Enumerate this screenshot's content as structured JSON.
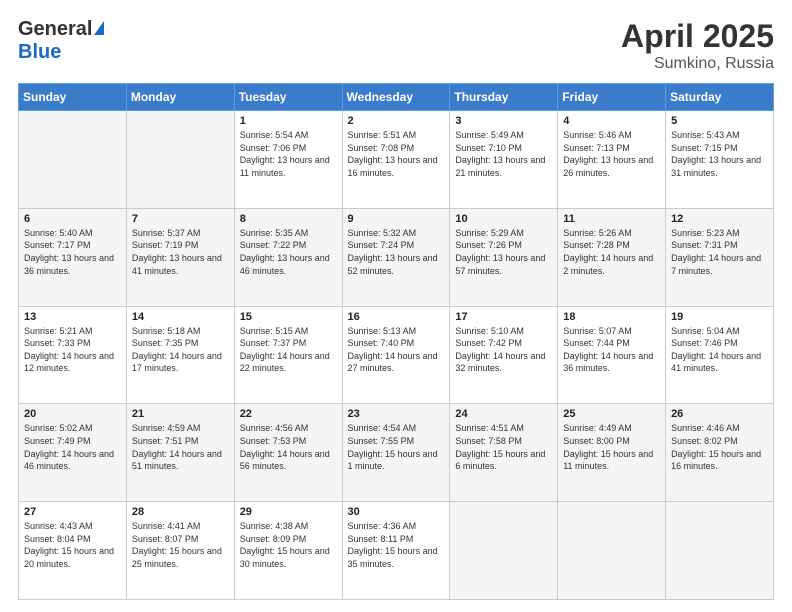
{
  "header": {
    "logo": {
      "general": "General",
      "blue": "Blue"
    },
    "title": "April 2025",
    "location": "Sumkino, Russia"
  },
  "calendar": {
    "days": [
      "Sunday",
      "Monday",
      "Tuesday",
      "Wednesday",
      "Thursday",
      "Friday",
      "Saturday"
    ],
    "weeks": [
      [
        {
          "day": "",
          "info": ""
        },
        {
          "day": "",
          "info": ""
        },
        {
          "day": "1",
          "info": "Sunrise: 5:54 AM\nSunset: 7:06 PM\nDaylight: 13 hours and 11 minutes."
        },
        {
          "day": "2",
          "info": "Sunrise: 5:51 AM\nSunset: 7:08 PM\nDaylight: 13 hours and 16 minutes."
        },
        {
          "day": "3",
          "info": "Sunrise: 5:49 AM\nSunset: 7:10 PM\nDaylight: 13 hours and 21 minutes."
        },
        {
          "day": "4",
          "info": "Sunrise: 5:46 AM\nSunset: 7:13 PM\nDaylight: 13 hours and 26 minutes."
        },
        {
          "day": "5",
          "info": "Sunrise: 5:43 AM\nSunset: 7:15 PM\nDaylight: 13 hours and 31 minutes."
        }
      ],
      [
        {
          "day": "6",
          "info": "Sunrise: 5:40 AM\nSunset: 7:17 PM\nDaylight: 13 hours and 36 minutes."
        },
        {
          "day": "7",
          "info": "Sunrise: 5:37 AM\nSunset: 7:19 PM\nDaylight: 13 hours and 41 minutes."
        },
        {
          "day": "8",
          "info": "Sunrise: 5:35 AM\nSunset: 7:22 PM\nDaylight: 13 hours and 46 minutes."
        },
        {
          "day": "9",
          "info": "Sunrise: 5:32 AM\nSunset: 7:24 PM\nDaylight: 13 hours and 52 minutes."
        },
        {
          "day": "10",
          "info": "Sunrise: 5:29 AM\nSunset: 7:26 PM\nDaylight: 13 hours and 57 minutes."
        },
        {
          "day": "11",
          "info": "Sunrise: 5:26 AM\nSunset: 7:28 PM\nDaylight: 14 hours and 2 minutes."
        },
        {
          "day": "12",
          "info": "Sunrise: 5:23 AM\nSunset: 7:31 PM\nDaylight: 14 hours and 7 minutes."
        }
      ],
      [
        {
          "day": "13",
          "info": "Sunrise: 5:21 AM\nSunset: 7:33 PM\nDaylight: 14 hours and 12 minutes."
        },
        {
          "day": "14",
          "info": "Sunrise: 5:18 AM\nSunset: 7:35 PM\nDaylight: 14 hours and 17 minutes."
        },
        {
          "day": "15",
          "info": "Sunrise: 5:15 AM\nSunset: 7:37 PM\nDaylight: 14 hours and 22 minutes."
        },
        {
          "day": "16",
          "info": "Sunrise: 5:13 AM\nSunset: 7:40 PM\nDaylight: 14 hours and 27 minutes."
        },
        {
          "day": "17",
          "info": "Sunrise: 5:10 AM\nSunset: 7:42 PM\nDaylight: 14 hours and 32 minutes."
        },
        {
          "day": "18",
          "info": "Sunrise: 5:07 AM\nSunset: 7:44 PM\nDaylight: 14 hours and 36 minutes."
        },
        {
          "day": "19",
          "info": "Sunrise: 5:04 AM\nSunset: 7:46 PM\nDaylight: 14 hours and 41 minutes."
        }
      ],
      [
        {
          "day": "20",
          "info": "Sunrise: 5:02 AM\nSunset: 7:49 PM\nDaylight: 14 hours and 46 minutes."
        },
        {
          "day": "21",
          "info": "Sunrise: 4:59 AM\nSunset: 7:51 PM\nDaylight: 14 hours and 51 minutes."
        },
        {
          "day": "22",
          "info": "Sunrise: 4:56 AM\nSunset: 7:53 PM\nDaylight: 14 hours and 56 minutes."
        },
        {
          "day": "23",
          "info": "Sunrise: 4:54 AM\nSunset: 7:55 PM\nDaylight: 15 hours and 1 minute."
        },
        {
          "day": "24",
          "info": "Sunrise: 4:51 AM\nSunset: 7:58 PM\nDaylight: 15 hours and 6 minutes."
        },
        {
          "day": "25",
          "info": "Sunrise: 4:49 AM\nSunset: 8:00 PM\nDaylight: 15 hours and 11 minutes."
        },
        {
          "day": "26",
          "info": "Sunrise: 4:46 AM\nSunset: 8:02 PM\nDaylight: 15 hours and 16 minutes."
        }
      ],
      [
        {
          "day": "27",
          "info": "Sunrise: 4:43 AM\nSunset: 8:04 PM\nDaylight: 15 hours and 20 minutes."
        },
        {
          "day": "28",
          "info": "Sunrise: 4:41 AM\nSunset: 8:07 PM\nDaylight: 15 hours and 25 minutes."
        },
        {
          "day": "29",
          "info": "Sunrise: 4:38 AM\nSunset: 8:09 PM\nDaylight: 15 hours and 30 minutes."
        },
        {
          "day": "30",
          "info": "Sunrise: 4:36 AM\nSunset: 8:11 PM\nDaylight: 15 hours and 35 minutes."
        },
        {
          "day": "",
          "info": ""
        },
        {
          "day": "",
          "info": ""
        },
        {
          "day": "",
          "info": ""
        }
      ]
    ]
  }
}
